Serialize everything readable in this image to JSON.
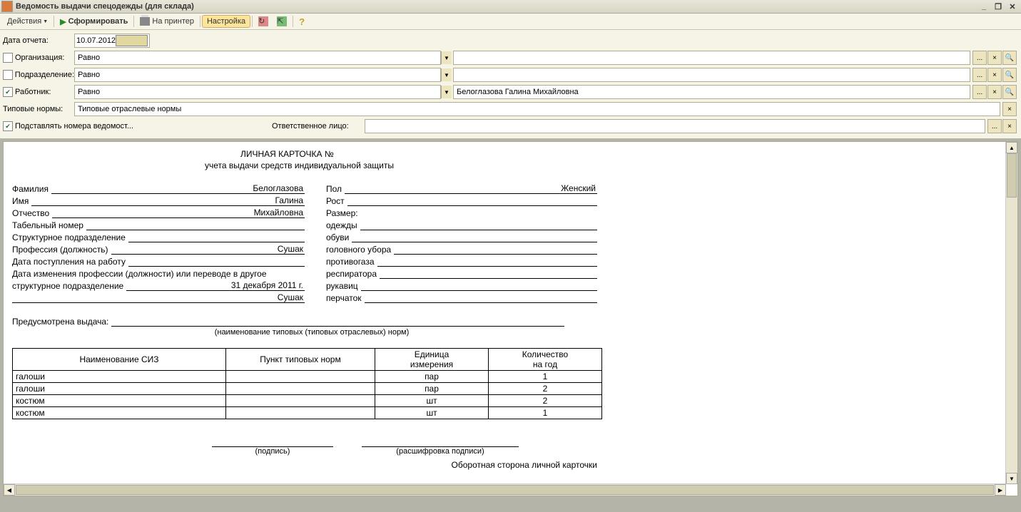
{
  "window": {
    "title": "Ведомость выдачи спецодежды (для склада)"
  },
  "toolbar": {
    "actions": "Действия",
    "generate": "Сформировать",
    "print": "На принтер",
    "settings": "Настройка"
  },
  "filters": {
    "dateLabel": "Дата отчета:",
    "dateValue": "10.07.2012",
    "orgLabel": "Организация:",
    "deptLabel": "Подразделение:",
    "workerLabel": "Работник:",
    "normsLabel": "Типовые нормы:",
    "equals": "Равно",
    "workerValue": "Белоглазова Галина Михайловна",
    "normsValue": "Типовые отраслевые нормы",
    "substitute": "Подставлять номера ведомост...",
    "responsible": "Ответственное лицо:"
  },
  "doc": {
    "title": "ЛИЧНАЯ КАРТОЧКА №",
    "subtitle": "учета выдачи средств индивидуальной защиты",
    "leftLabels": {
      "surname": "Фамилия",
      "name": "Имя",
      "patronym": "Отчество",
      "tabnum": "Табельный номер",
      "dept": "Структурное подразделение",
      "profession": "Профессия (должность)",
      "hireDate": "Дата поступления на работу",
      "changeDate1": "Дата изменения профессии (должности) или переводе в другое",
      "changeDate2": "структурное подразделение"
    },
    "leftValues": {
      "surname": "Белоглазова",
      "name": "Галина",
      "patronym": "Михайловна",
      "profession": "Сушак",
      "changeDate": "31 декабря 2011 г.",
      "changeExtra": "Сушак"
    },
    "rightLabels": {
      "sex": "Пол",
      "height": "Рост",
      "size": "Размер:",
      "clothes": "одежды",
      "shoes": "обуви",
      "head": "головного убора",
      "mask": "противогаза",
      "resp": "респиратора",
      "mitt": "рукавиц",
      "gloves": "перчаток"
    },
    "rightValues": {
      "sex": "Женский"
    },
    "issueLabel": "Предусмотрена выдача:",
    "normsNote": "(наименование типовых (типовых отраслевых) норм)",
    "tableHeaders": {
      "name": "Наименование СИЗ",
      "point": "Пункт типовых норм",
      "unit": "Единица измерения",
      "qty": "Количество на год"
    },
    "tableUnitSub": "измерения",
    "tableQtySub": "на год",
    "rows": [
      {
        "name": "галоши",
        "point": "",
        "unit": "пар",
        "qty": "1"
      },
      {
        "name": "галоши",
        "point": "",
        "unit": "пар",
        "qty": "2"
      },
      {
        "name": "костюм",
        "point": "",
        "unit": "шт",
        "qty": "2"
      },
      {
        "name": "костюм",
        "point": "",
        "unit": "шт",
        "qty": "1"
      }
    ],
    "signLabel": "(подпись)",
    "decryption": "(расшифровка подписи)",
    "reverse": "Оборотная сторона личной карточки"
  }
}
